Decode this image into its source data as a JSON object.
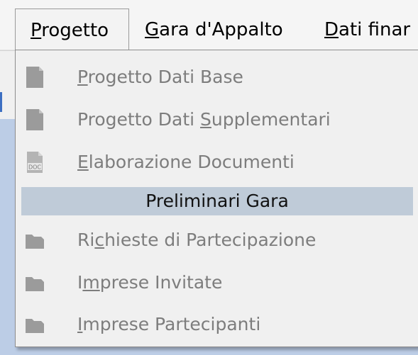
{
  "menubar": {
    "items": [
      {
        "pre": "",
        "u": "P",
        "post": "rogetto"
      },
      {
        "pre": "",
        "u": "G",
        "post": "ara d'Appalto"
      },
      {
        "pre": "",
        "u": "D",
        "post": "ati finar"
      }
    ]
  },
  "menu": {
    "items": [
      {
        "pre": "",
        "u": "P",
        "post": "rogetto Dati Base",
        "icon": "document-icon",
        "enabled": false
      },
      {
        "pre": "Progetto Dati ",
        "u": "S",
        "post": "upplementari",
        "icon": "document-icon",
        "enabled": false
      },
      {
        "pre": "",
        "u": "E",
        "post": "laborazione Documenti",
        "icon": "doc-file-icon",
        "enabled": false
      },
      {
        "text": "Preliminari Gara",
        "highlighted": true
      },
      {
        "pre": "Ri",
        "u": "c",
        "post": "hieste di Partecipazione",
        "icon": "folder-icon",
        "enabled": false
      },
      {
        "pre": "I",
        "u": "m",
        "post": "prese Invitate",
        "icon": "folder-icon",
        "enabled": false
      },
      {
        "pre": "",
        "u": "I",
        "post": "mprese Partecipanti",
        "icon": "folder-icon",
        "enabled": false
      }
    ]
  },
  "colors": {
    "menu_background": "#f0f0f0",
    "highlight": "#bfcbd8",
    "disabled_text": "#7d7d7d",
    "disabled_icon": "#9b9b9b",
    "app_background": "#bccde6"
  }
}
